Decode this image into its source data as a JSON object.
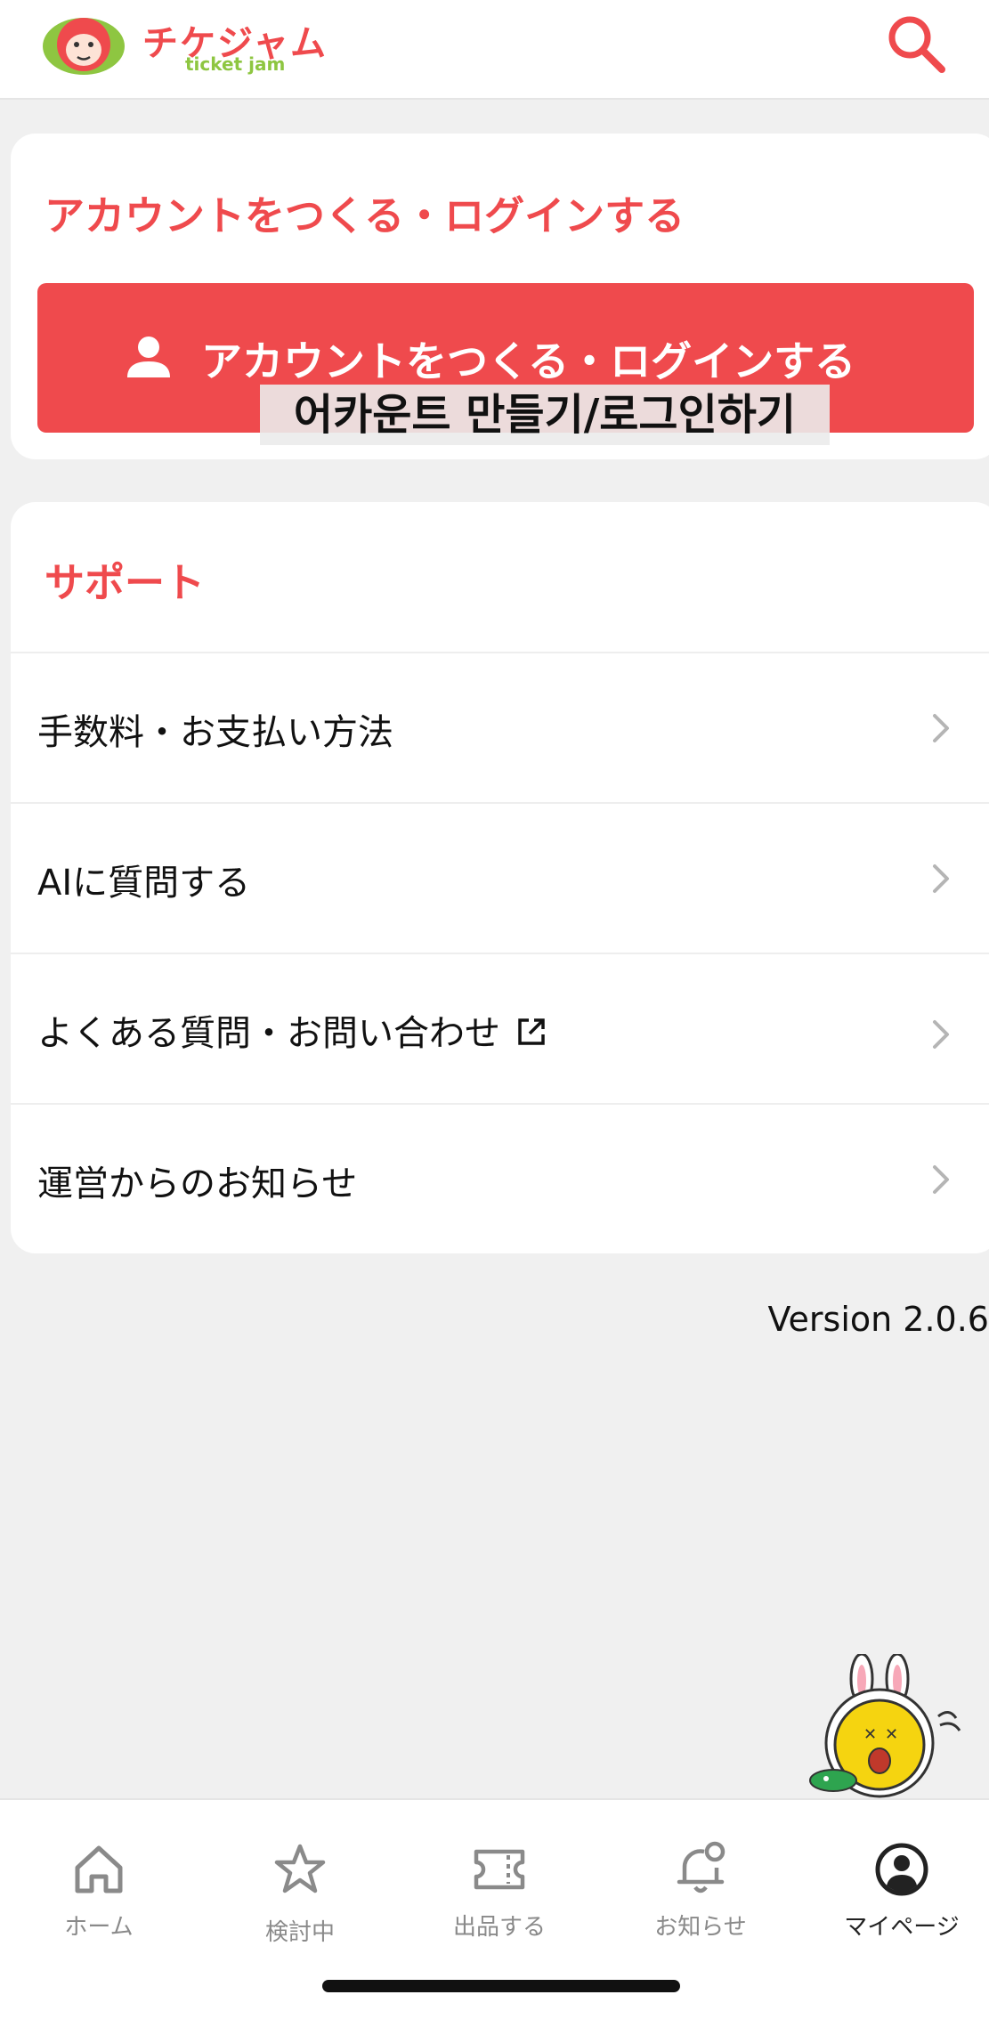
{
  "header": {
    "logo_title": "チケジャム",
    "logo_subtitle": "ticket jam",
    "search_icon": "search-icon"
  },
  "account": {
    "title": "アカウントをつくる・ログインする",
    "button_label": "アカウントをつくる・ログインする",
    "button_icon": "person-icon",
    "overlay_text": "어카운트 만들기/로그인하기"
  },
  "support": {
    "title": "サポート",
    "items": [
      {
        "label": "手数料・お支払い方法"
      },
      {
        "label": "AIに質問する"
      },
      {
        "label": "よくある質問・お問い合わせ",
        "icon": "external-link-icon"
      },
      {
        "label": "運営からのお知らせ"
      }
    ]
  },
  "version": "Version 2.0.6",
  "nav": {
    "items": [
      {
        "label": "ホーム",
        "icon": "home-icon",
        "active": false
      },
      {
        "label": "検討中",
        "icon": "star-icon",
        "active": false
      },
      {
        "label": "出品する",
        "icon": "ticket-icon",
        "active": false
      },
      {
        "label": "お知らせ",
        "icon": "bell-icon",
        "active": false
      },
      {
        "label": "マイページ",
        "icon": "account-circle-icon",
        "active": true
      }
    ]
  },
  "colors": {
    "brand_red": "#ef4a4d",
    "brand_green": "#8ec641",
    "background": "#f0f0f0"
  }
}
